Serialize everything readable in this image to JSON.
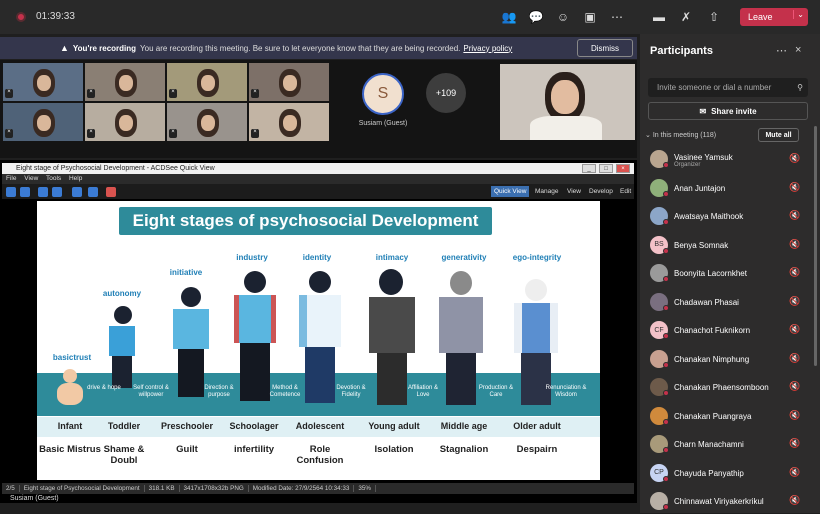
{
  "topbar": {
    "timer": "01:39:33",
    "leave_label": "Leave",
    "icons": [
      "people-icon",
      "chat-icon",
      "reactions-icon",
      "rooms-icon",
      "more-icon",
      "camera-icon",
      "mic-off-icon",
      "share-icon"
    ]
  },
  "banner": {
    "strong": "You're recording",
    "text": "You are recording this meeting. Be sure to let everyone know that they are being recorded.",
    "link": "Privacy policy",
    "dismiss": "Dismiss"
  },
  "gallery": {
    "featured_initial": "S",
    "featured_name": "Susiam (Guest)",
    "overflow_count": "+109"
  },
  "viewer": {
    "title": "Eight stage of Psychosocial Development - ACDSee Quick View",
    "menu": [
      "File",
      "View",
      "Tools",
      "Help"
    ],
    "modes": [
      "Quick View",
      "Manage",
      "View",
      "Develop",
      "Edit"
    ],
    "status": [
      "2/5",
      "Eight stage of Psychosocial Development",
      "318.1 KB",
      "3417x1708x32b PNG",
      "Modified Date: 27/9/2564 10:34:33",
      "35%"
    ],
    "presenter_label": "Susiam (Guest)"
  },
  "slide": {
    "title": "Eight stages of psychosocial Development",
    "stages": [
      {
        "virtue_word": "basictrust",
        "band": "",
        "age": "Infant",
        "crisis": "Basic Mistrus"
      },
      {
        "virtue_word": "autonomy",
        "band": "drive & hope",
        "age": "Toddler",
        "crisis": "Shame & Doubl"
      },
      {
        "virtue_word": "initiative",
        "band": "Self control & willpower",
        "age": "Preschooler",
        "crisis": "Guilt"
      },
      {
        "virtue_word": "industry",
        "band": "Direction & purpose",
        "age": "Schoolager",
        "crisis": "infertility"
      },
      {
        "virtue_word": "identity",
        "band": "Method & Cometence",
        "age": "Adolescent",
        "crisis": "Role Confusion"
      },
      {
        "virtue_word": "intimacy",
        "band": "Devotion & Fidelity",
        "age": "Young adult",
        "crisis": "Isolation"
      },
      {
        "virtue_word": "generativity",
        "band": "Affiliation & Love",
        "age": "Middle age",
        "crisis": "Stagnalion"
      },
      {
        "virtue_word": "ego-integrity",
        "band": "Production & Care",
        "age": "Older adult",
        "crisis": "Despairn"
      }
    ],
    "last_band": "Renunciation & Wisdom"
  },
  "panel": {
    "title": "Participants",
    "invite_placeholder": "Invite someone or dial a number",
    "share_invite": "Share invite",
    "in_meeting": "In this meeting (118)",
    "mute_all": "Mute all",
    "participants": [
      {
        "name": "Vasinee Yamsuk",
        "role": "Organizer",
        "initials": "",
        "color": "#b9a58f"
      },
      {
        "name": "Anan Juntajon",
        "role": "",
        "initials": "",
        "color": "#8fb07a"
      },
      {
        "name": "Awatsaya Maithook",
        "role": "",
        "initials": "",
        "color": "#8ca6c8"
      },
      {
        "name": "Benya Somnak",
        "role": "",
        "initials": "BS",
        "color": "#f3c1c8"
      },
      {
        "name": "Boonyita Lacornkhet",
        "role": "",
        "initials": "",
        "color": "#9a9a9a"
      },
      {
        "name": "Chadawan Phasai",
        "role": "",
        "initials": "",
        "color": "#7a6f80"
      },
      {
        "name": "Chanachot Fuknikorn",
        "role": "",
        "initials": "CF",
        "color": "#f3c1c8"
      },
      {
        "name": "Chanakan Nimphung",
        "role": "",
        "initials": "",
        "color": "#c8a090"
      },
      {
        "name": "Chanakan Phaensomboon",
        "role": "",
        "initials": "",
        "color": "#6d5a4a"
      },
      {
        "name": "Chanakan Puangraya",
        "role": "",
        "initials": "",
        "color": "#d08a3c"
      },
      {
        "name": "Charn Manachamni",
        "role": "",
        "initials": "",
        "color": "#a89a7a"
      },
      {
        "name": "Chayuda Panyathip",
        "role": "",
        "initials": "CP",
        "color": "#c7d4f3"
      },
      {
        "name": "Chinnawat Viriyakerkrikul",
        "role": "",
        "initials": "",
        "color": "#b8b0a6"
      }
    ]
  }
}
